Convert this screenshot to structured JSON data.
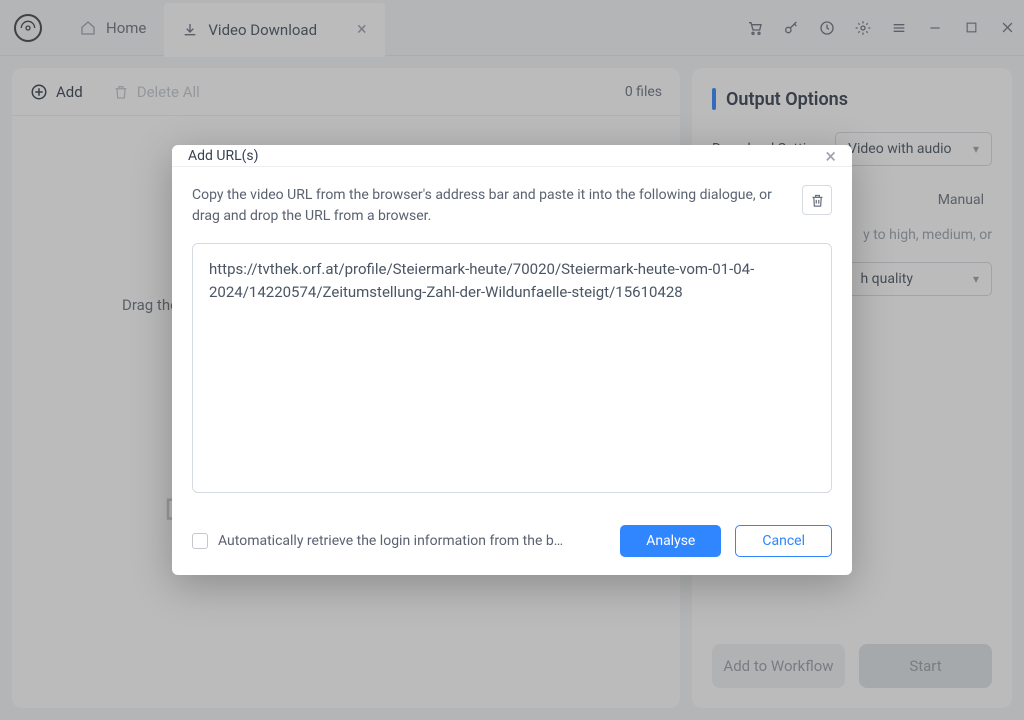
{
  "titlebar": {
    "tabs": {
      "home": "Home",
      "download": "Video Download"
    }
  },
  "toolbar": {
    "add": "Add",
    "delete_all": "Delete All",
    "files": "0 files"
  },
  "dragzone": {
    "text": "Drag the"
  },
  "right": {
    "title": "Output Options",
    "download_setting_label": "Download Setting:",
    "download_setting_value": "Video with audio",
    "tab_manual": "Manual",
    "help": "y to high, medium, or",
    "quality_value": "h quality",
    "btn_workflow": "Add to Workflow",
    "btn_start": "Start"
  },
  "modal": {
    "title": "Add URL(s)",
    "instruction": "Copy the video URL from the browser's address bar and paste it into the following dialogue, or drag and drop the URL from a browser.",
    "url": "https://tvthek.orf.at/profile/Steiermark-heute/70020/Steiermark-heute-vom-01-04-2024/14220574/Zeitumstellung-Zahl-der-Wildunfaelle-steigt/15610428",
    "checkbox_label": "Automatically retrieve the login information from the b…",
    "analyse": "Analyse",
    "cancel": "Cancel"
  }
}
